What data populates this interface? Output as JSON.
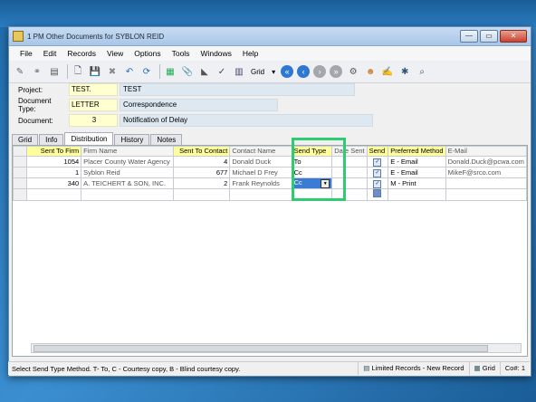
{
  "window": {
    "title": "1 PM Other Documents for SYBLON REID",
    "min": "—",
    "max": "▭",
    "close": "✕"
  },
  "menu": [
    "File",
    "Edit",
    "Records",
    "View",
    "Options",
    "Tools",
    "Windows",
    "Help"
  ],
  "toolbar": {
    "grid_label": "Grid"
  },
  "header": {
    "project": {
      "label": "Project:",
      "code": "TEST.",
      "desc": "TEST"
    },
    "doc_type": {
      "label": "Document Type:",
      "code": "LETTER",
      "desc": "Correspondence"
    },
    "document": {
      "label": "Document:",
      "code": "3",
      "desc": "Notification of Delay"
    }
  },
  "tabs": [
    "Grid",
    "Info",
    "Distribution",
    "History",
    "Notes"
  ],
  "grid": {
    "columns": [
      "Sent To Firm",
      "Firm Name",
      "Sent To Contact",
      "Contact Name",
      "Send Type",
      "Date Sent",
      "Send",
      "Preferred Method",
      "E-Mail"
    ],
    "rows": [
      {
        "firm": "1054",
        "firm_name": "Placer County Water Agency",
        "contact": "4",
        "contact_name": "Donald  Duck",
        "send_type": "To",
        "date_sent": "",
        "send": "✓",
        "method": "E - Email",
        "email": "Donald.Duck@pcwa.com"
      },
      {
        "firm": "1",
        "firm_name": "Syblon Reid",
        "contact": "677",
        "contact_name": "Michael D Frey",
        "send_type": "Cc",
        "date_sent": "",
        "send": "✓",
        "method": "E - Email",
        "email": "MikeF@srco.com"
      },
      {
        "firm": "340",
        "firm_name": "A. TEICHERT & SON, INC.",
        "contact": "2",
        "contact_name": "Frank  Reynolds",
        "send_type": "Cc",
        "date_sent": "",
        "send": "✓",
        "method": "M - Print",
        "email": ""
      }
    ]
  },
  "status": {
    "message": "Select Send Type Method. T- To, C - Courtesy copy, B - Blind courtesy copy.",
    "records": "Limited Records - New Record",
    "view": "Grid",
    "co": "Co#: 1"
  }
}
